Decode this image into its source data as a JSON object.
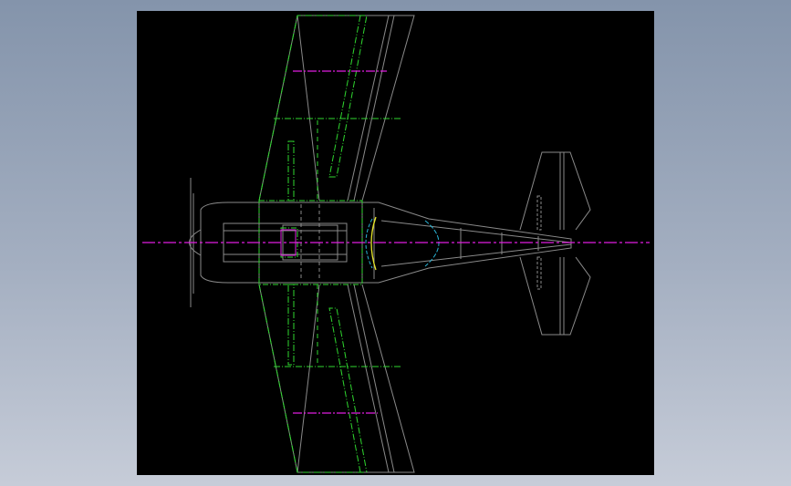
{
  "viewport": {
    "background": "#000000"
  },
  "colors": {
    "outline": "#8a8a8a",
    "wing_structure": "#2fd82f",
    "centerline": "#e01ee0",
    "canopy_front": "#e6e62a",
    "canopy_rear": "#2ab4d6"
  },
  "drawing": {
    "subject": "aircraft-top-view",
    "view": "top"
  }
}
